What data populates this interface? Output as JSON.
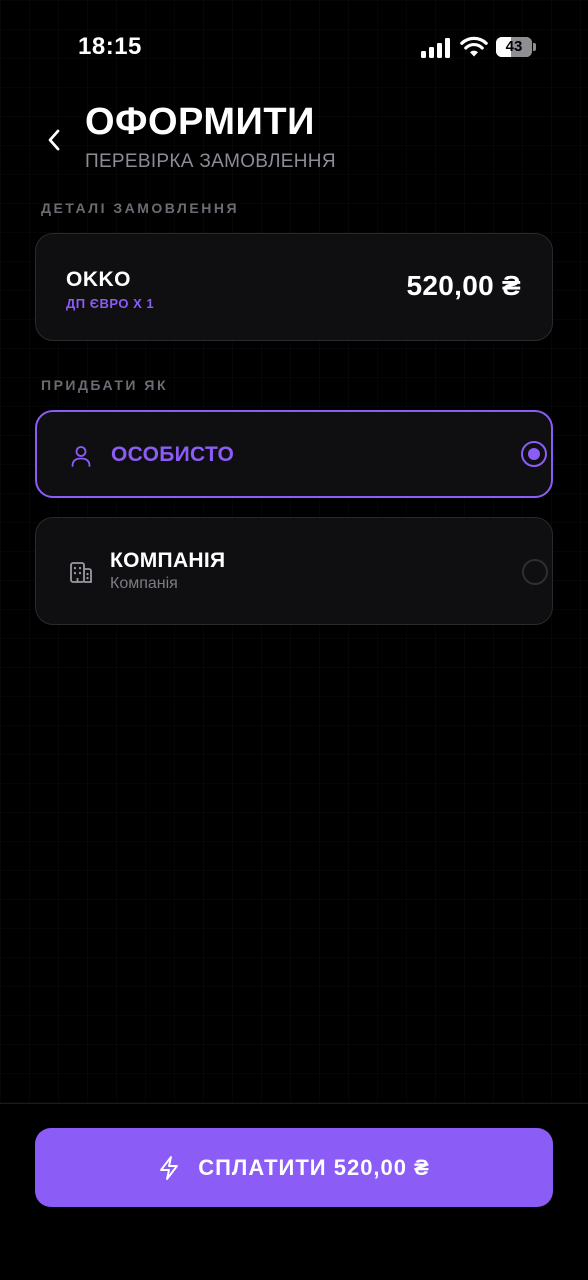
{
  "status_bar": {
    "time": "18:15",
    "battery_level": "43",
    "battery_fraction": 0.43
  },
  "header": {
    "title": "ОФОРМИТИ",
    "subtitle": "ПЕРЕВІРКА ЗАМОВЛЕННЯ",
    "back_icon": "chevron-left-icon"
  },
  "order_details": {
    "section_label": "ДЕТАЛІ ЗАМОВЛЕННЯ",
    "merchant": "OKKO",
    "item": "ДП ЄВРО Х 1",
    "price": "520,00 ₴"
  },
  "purchase_as": {
    "section_label": "ПРИДБАТИ ЯК",
    "options": [
      {
        "label": "ОСОБИСТО",
        "sub": "",
        "icon": "user-icon",
        "selected": true
      },
      {
        "label": "КОМПАНІЯ",
        "sub": "Компанія",
        "icon": "building-icon",
        "selected": false
      }
    ]
  },
  "pay_button": {
    "label": "СПЛАТИТИ 520,00 ₴",
    "icon": "lightning-icon"
  },
  "colors": {
    "accent": "#8b5cf6",
    "background": "#000000",
    "card": "#0f0f11"
  }
}
